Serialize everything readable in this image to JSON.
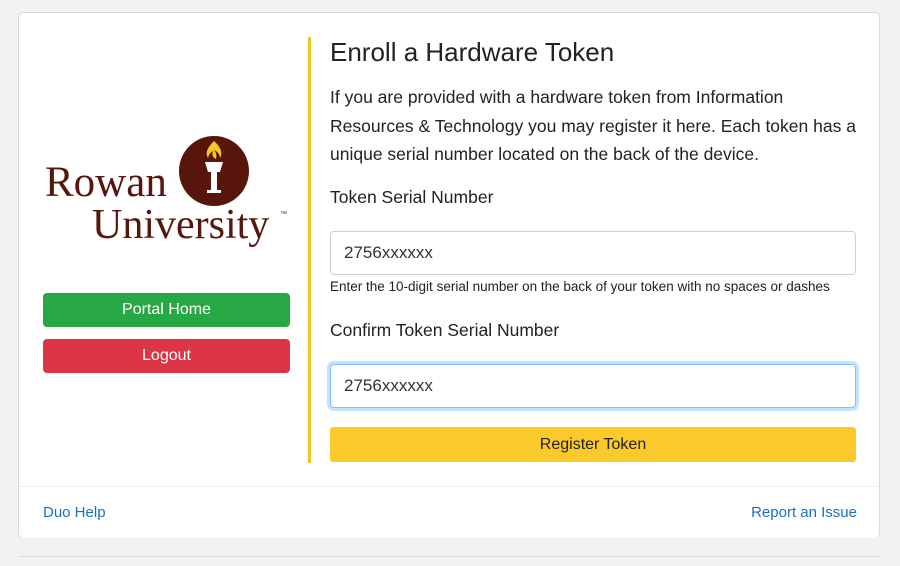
{
  "brand": {
    "logo_word_1": "Rowan",
    "logo_word_2": "University",
    "trademark": "™",
    "maroon": "#57150b",
    "gold": "#f4c623"
  },
  "sidebar": {
    "portal_home_label": "Portal Home",
    "logout_label": "Logout",
    "portal_color": "#28a745",
    "logout_color": "#dc3545"
  },
  "main": {
    "title": "Enroll a Hardware Token",
    "intro": "If you are provided with a hardware token from Information Resources & Technology you may register it here. Each token has a unique serial number located on the back of the device.",
    "serial_label": "Token Serial Number",
    "serial_value": "2756xxxxxx",
    "serial_help": "Enter the 10-digit serial number on the back of your token with no spaces or dashes",
    "confirm_label": "Confirm Token Serial Number",
    "confirm_value": "2756xxxxxx",
    "register_label": "Register Token",
    "register_color": "#fcc92b"
  },
  "footer": {
    "help_link": "Duo Help",
    "report_link": "Report an Issue"
  }
}
